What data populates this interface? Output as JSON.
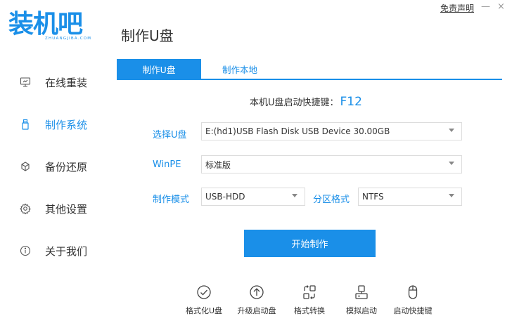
{
  "window": {
    "disclaimer": "免责声明",
    "minimize": "—",
    "close": "×"
  },
  "logo": {
    "text": "装机吧",
    "sub": "ZHUANGJIBA.COM",
    "color": "#1a8fe8"
  },
  "sidebar": {
    "items": [
      {
        "label": "在线重装",
        "icon": "monitor-icon",
        "active": false
      },
      {
        "label": "制作系统",
        "icon": "usb-drive-icon",
        "active": true
      },
      {
        "label": "备份还原",
        "icon": "backup-icon",
        "active": false
      },
      {
        "label": "其他设置",
        "icon": "gear-icon",
        "active": false
      },
      {
        "label": "关于我们",
        "icon": "info-icon",
        "active": false
      }
    ]
  },
  "main": {
    "title": "制作U盘",
    "tabs": [
      {
        "label": "制作U盘",
        "active": true
      },
      {
        "label": "制作本地",
        "active": false
      }
    ],
    "hotkey_text": "本机U盘启动快捷键：",
    "hotkey_key": "F12",
    "form": {
      "usb_label": "选择U盘",
      "usb_value": "E:(hd1)USB Flash Disk USB Device 30.00GB",
      "winpe_label": "WinPE",
      "winpe_value": "标准版",
      "mode_label": "制作模式",
      "mode_value": "USB-HDD",
      "partition_label": "分区格式",
      "partition_value": "NTFS"
    },
    "start_button": "开始制作"
  },
  "tools": [
    {
      "label": "格式化U盘",
      "icon": "check-circle-icon"
    },
    {
      "label": "升级启动盘",
      "icon": "upgrade-icon"
    },
    {
      "label": "格式转换",
      "icon": "convert-icon"
    },
    {
      "label": "模拟启动",
      "icon": "simulate-icon"
    },
    {
      "label": "启动快捷键",
      "icon": "mouse-icon"
    }
  ],
  "colors": {
    "accent": "#1a8fe8",
    "text": "#333333",
    "border": "#dcdcdc"
  }
}
